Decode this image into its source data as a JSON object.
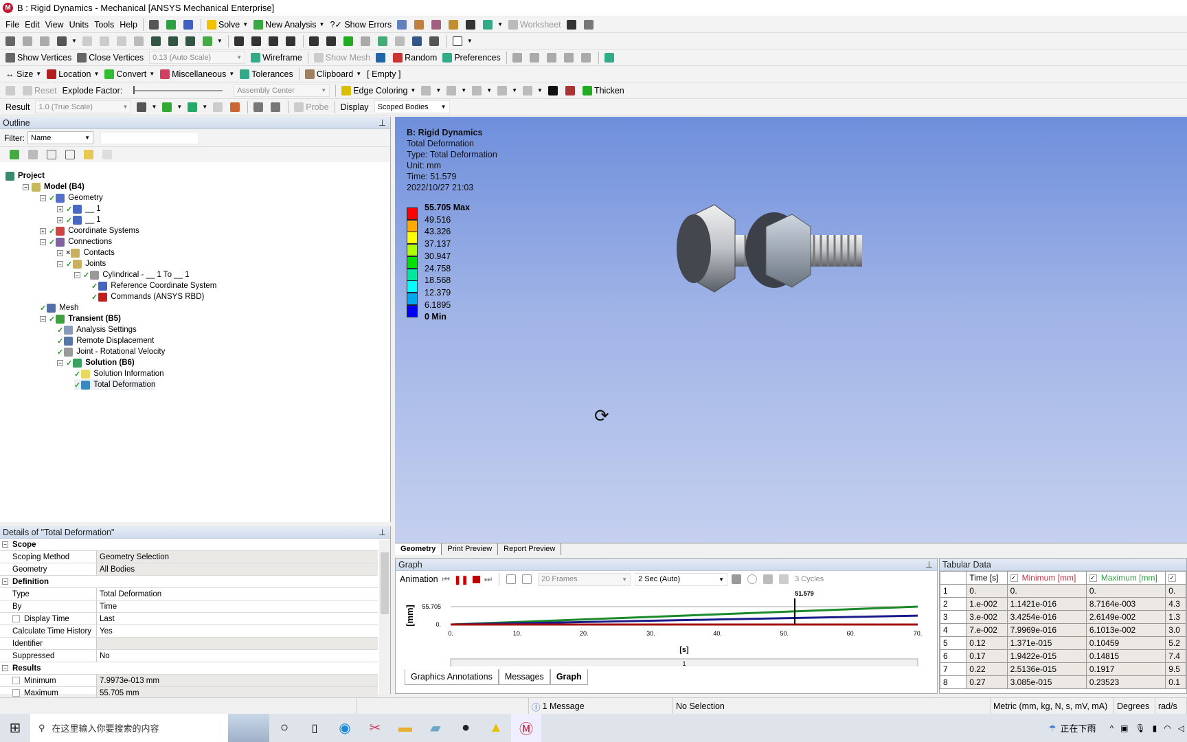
{
  "window": {
    "title": "B : Rigid Dynamics - Mechanical [ANSYS Mechanical Enterprise]",
    "app_icon": "M"
  },
  "toolbars": [
    [
      {
        "label": "File"
      },
      {
        "label": "Edit"
      },
      {
        "label": "View"
      },
      {
        "label": "Units"
      },
      {
        "label": "Tools"
      },
      {
        "label": "Help"
      },
      {
        "sep": 1
      },
      {
        "icon": "command-prompt-icon",
        "color": "#555"
      },
      {
        "icon": "check-icon",
        "color": "#2ea043"
      },
      {
        "icon": "insert-icon",
        "color": "#4060c0"
      },
      {
        "sep": 1
      },
      {
        "icon": "lightning-icon",
        "color": "#f2c200",
        "label": "Solve",
        "dd": 1
      },
      {
        "icon": "new-analysis-icon",
        "color": "#3aa840",
        "label": "New Analysis",
        "dd": 1
      },
      {
        "label": "?✓ Show Errors"
      },
      {
        "icon": "table-icon",
        "color": "#6080c0"
      },
      {
        "icon": "chart-icon",
        "color": "#c08040"
      },
      {
        "icon": "probe-icon",
        "color": "#a06080"
      },
      {
        "icon": "mesh-icon",
        "color": "#c09030"
      },
      {
        "icon": "text-icon",
        "color": "#333"
      },
      {
        "icon": "view-icon",
        "color": "#3a8",
        "dd": 1
      },
      {
        "icon": "worksheet-icon",
        "color": "#bbb",
        "label": "Worksheet",
        "dis": 1
      },
      {
        "icon": "pointer-icon",
        "color": "#333"
      },
      {
        "icon": "tag-icon",
        "color": "#777"
      }
    ],
    [
      {
        "icon": "select-icon",
        "color": "#666"
      },
      {
        "icon": "select-2-icon",
        "color": "#aaa"
      },
      {
        "icon": "select-3-icon",
        "color": "#aaa"
      },
      {
        "icon": "cursor-icon",
        "color": "#555",
        "dd": 1
      },
      {
        "icon": "vertex-icon",
        "color": "#ccc"
      },
      {
        "icon": "edge-icon",
        "color": "#ccc"
      },
      {
        "icon": "face-icon",
        "color": "#ccc"
      },
      {
        "icon": "body-icon",
        "color": "#bbb"
      },
      {
        "icon": "box-select-icon",
        "color": "#354"
      },
      {
        "icon": "box-select-2-icon",
        "color": "#354"
      },
      {
        "icon": "box-select-3-icon",
        "color": "#354"
      },
      {
        "icon": "named-select-icon",
        "color": "#4a4",
        "dd": 1
      },
      {
        "sep": 1
      },
      {
        "icon": "rotate-icon",
        "color": "#333"
      },
      {
        "icon": "pan-icon",
        "color": "#333"
      },
      {
        "icon": "zoom-icon",
        "color": "#333"
      },
      {
        "icon": "zoom-box-icon",
        "color": "#333"
      },
      {
        "sep": 1
      },
      {
        "icon": "zoom-fit-icon",
        "color": "#333"
      },
      {
        "icon": "zoom-window-icon",
        "color": "#333"
      },
      {
        "icon": "previous-view-icon",
        "color": "#2a2"
      },
      {
        "icon": "magnifier-icon",
        "color": "#aaa"
      },
      {
        "icon": "iso-icon",
        "color": "#4a7"
      },
      {
        "icon": "hide-icon",
        "color": "#bbb"
      },
      {
        "icon": "look-at-icon",
        "color": "#358"
      },
      {
        "icon": "print-icon",
        "color": "#555"
      },
      {
        "sep": 1
      },
      {
        "icon": "window-icon",
        "color": "#fff",
        "dd": 1
      }
    ],
    [
      {
        "icon": "vertices-icon",
        "color": "#666",
        "label": "Show Vertices"
      },
      {
        "icon": "close-vertices-icon",
        "color": "#666",
        "label": "Close Vertices"
      },
      {
        "combo": "0.13 (Auto Scale)",
        "w": 140
      },
      {
        "icon": "wireframe-icon",
        "color": "#3a8",
        "label": "Wireframe"
      },
      {
        "sep": 1
      },
      {
        "icon": "show-mesh-icon",
        "color": "#ccc",
        "label": "Show Mesh",
        "dis": 1
      },
      {
        "icon": "axes-icon",
        "color": "#26a"
      },
      {
        "icon": "random-colors-icon",
        "color": "#c33",
        "label": "Random"
      },
      {
        "icon": "preferences-icon",
        "color": "#3a8",
        "label": "Preferences"
      },
      {
        "sep": 1
      },
      {
        "icon": "triad-1-icon",
        "color": "#aaa"
      },
      {
        "icon": "triad-2-icon",
        "color": "#aaa"
      },
      {
        "icon": "triad-3-icon",
        "color": "#aaa"
      },
      {
        "icon": "triad-4-icon",
        "color": "#aaa"
      },
      {
        "icon": "triad-5-icon",
        "color": "#aaa"
      },
      {
        "sep": 1
      },
      {
        "icon": "cube-icon",
        "color": "#3a8"
      }
    ],
    [
      {
        "label": "↔ Size",
        "dd": 1
      },
      {
        "icon": "location-icon",
        "color": "#b02020",
        "label": "Location",
        "dd": 1
      },
      {
        "icon": "convert-icon",
        "color": "#3b3",
        "label": "Convert",
        "dd": 1
      },
      {
        "icon": "miscellaneous-icon",
        "color": "#d04060",
        "label": "Miscellaneous",
        "dd": 1
      },
      {
        "icon": "tolerances-icon",
        "color": "#3a8",
        "label": "Tolerances"
      },
      {
        "sep": 1
      },
      {
        "icon": "clipboard-icon",
        "color": "#a08060",
        "label": "Clipboard",
        "dd": 1
      },
      {
        "label": "[ Empty ]"
      }
    ],
    [
      {
        "icon": "explode-icon",
        "color": "#ccc"
      },
      {
        "icon": "reset-icon",
        "color": "#ccc",
        "label": "Reset",
        "dis": 1
      },
      {
        "label": "Explode Factor:"
      },
      {
        "slider": 1
      },
      {
        "combo": "Assembly Center",
        "w": 140
      },
      {
        "sep": 1
      },
      {
        "icon": "edge-coloring-icon",
        "color": "#d8c000",
        "label": "Edge Coloring",
        "dd": 1
      },
      {
        "icon": "edge-0-icon",
        "color": "#bbb",
        "dd": 1
      },
      {
        "icon": "edge-1-icon",
        "color": "#bbb",
        "dd": 1
      },
      {
        "icon": "edge-2-icon",
        "color": "#bbb",
        "dd": 1
      },
      {
        "icon": "edge-3-icon",
        "color": "#bbb",
        "dd": 1
      },
      {
        "icon": "edge-x-icon",
        "color": "#bbb",
        "dd": 1
      },
      {
        "icon": "pin-icon",
        "color": "#111"
      },
      {
        "icon": "thin-icon",
        "color": "#a33"
      },
      {
        "icon": "thicken-icon",
        "color": "#2a2",
        "label": "Thicken"
      }
    ],
    [
      {
        "label": "Result"
      },
      {
        "combo": "1.0 (True Scale)",
        "w": 140
      },
      {
        "icon": "geometry-display-icon",
        "color": "#555",
        "dd": 1
      },
      {
        "icon": "contours-icon",
        "color": "#3a3",
        "dd": 1
      },
      {
        "icon": "edges-icon",
        "color": "#2a6",
        "dd": 1
      },
      {
        "icon": "vector-icon",
        "color": "#ccc"
      },
      {
        "icon": "arrows-icon",
        "color": "#c63"
      },
      {
        "sep": 1
      },
      {
        "icon": "max-icon",
        "color": "#777"
      },
      {
        "icon": "min-icon",
        "color": "#777"
      },
      {
        "sep": 1
      },
      {
        "icon": "probe-icon",
        "color": "#ccc",
        "label": "Probe",
        "dis": 1
      },
      {
        "sep": 1
      },
      {
        "label": "Display"
      },
      {
        "combo": "Scoped Bodies",
        "w": 110,
        "active": 1
      }
    ]
  ],
  "outline": {
    "title": "Outline",
    "filter_label": "Filter:",
    "filter_value": "Name",
    "tree": [
      {
        "label": "Project",
        "level": 0,
        "bold": 1,
        "icon": "project-icon",
        "color": "#3a8a6a"
      },
      {
        "label": "Model (B4)",
        "level": 1,
        "bold": 1,
        "exp": "-",
        "icon": "model-icon",
        "color": "#c8b860"
      },
      {
        "label": "Geometry",
        "level": 2,
        "exp": "-",
        "chk": 1,
        "icon": "geometry-icon",
        "color": "#5570c8"
      },
      {
        "label": "__ 1",
        "level": 3,
        "exp": "+",
        "chk": 1,
        "icon": "body-icon",
        "color": "#4a68c0"
      },
      {
        "label": "__ 1",
        "level": 3,
        "exp": "+",
        "chk": 1,
        "icon": "body-icon",
        "color": "#4a68c0"
      },
      {
        "label": "Coordinate Systems",
        "level": 2,
        "exp": "+",
        "chk": 1,
        "icon": "coordinate-systems-icon",
        "color": "#c44"
      },
      {
        "label": "Connections",
        "level": 2,
        "exp": "-",
        "chk": 1,
        "icon": "connections-icon",
        "color": "#8060a0"
      },
      {
        "label": "Contacts",
        "level": 3,
        "exp": "+",
        "chk": 0,
        "icon": "contacts-icon",
        "color": "#c8b060"
      },
      {
        "label": "Joints",
        "level": 3,
        "exp": "-",
        "chk": 1,
        "icon": "joints-icon",
        "color": "#c8b060"
      },
      {
        "label": "Cylindrical - __ 1 To __ 1",
        "level": 4,
        "exp": "-",
        "chk": 1,
        "icon": "joint-icon",
        "color": "#999"
      },
      {
        "label": "Reference Coordinate System",
        "level": 5,
        "chk": 1,
        "icon": "coordinate-system-icon",
        "color": "#4466c0"
      },
      {
        "label": "Commands (ANSYS RBD)",
        "level": 5,
        "chk": 1,
        "icon": "commands-icon",
        "color": "#c02020"
      },
      {
        "label": "Mesh",
        "level": 2,
        "chk": 1,
        "icon": "mesh-icon",
        "color": "#5570a8"
      },
      {
        "label": "Transient (B5)",
        "level": 2,
        "bold": 1,
        "exp": "-",
        "chk": 1,
        "icon": "transient-icon",
        "color": "#40a040"
      },
      {
        "label": "Analysis Settings",
        "level": 3,
        "chk": 1,
        "icon": "analysis-settings-icon",
        "color": "#8899bb"
      },
      {
        "label": "Remote Displacement",
        "level": 3,
        "chk": 1,
        "icon": "remote-displacement-icon",
        "color": "#5577aa"
      },
      {
        "label": "Joint - Rotational Velocity",
        "level": 3,
        "chk": 1,
        "icon": "joint-velocity-icon",
        "color": "#999"
      },
      {
        "label": "Solution (B6)",
        "level": 3,
        "bold": 1,
        "exp": "-",
        "chk": 1,
        "icon": "solution-icon",
        "color": "#3aa060"
      },
      {
        "label": "Solution Information",
        "level": 4,
        "chk": 1,
        "icon": "solution-information-icon",
        "color": "#e8d860"
      },
      {
        "label": "Total Deformation",
        "level": 4,
        "chk": 1,
        "icon": "total-deformation-icon",
        "color": "#3a8ac0",
        "selected": 1
      }
    ]
  },
  "details": {
    "title": "Details of \"Total Deformation\"",
    "rows": [
      {
        "group": "Scope"
      },
      {
        "k": "Scoping Method",
        "v": "Geometry Selection",
        "shade": 1
      },
      {
        "k": "Geometry",
        "v": "All Bodies",
        "shade": 1
      },
      {
        "group": "Definition"
      },
      {
        "k": "Type",
        "v": "Total Deformation"
      },
      {
        "k": "By",
        "v": "Time"
      },
      {
        "k": "Display Time",
        "v": "Last",
        "cb": 1
      },
      {
        "k": "Calculate Time History",
        "v": "Yes"
      },
      {
        "k": "Identifier",
        "v": "",
        "shade": 1
      },
      {
        "k": "Suppressed",
        "v": "No"
      },
      {
        "group": "Results"
      },
      {
        "k": "Minimum",
        "v": "7.9973e-013 mm",
        "cb": 1,
        "shade": 1
      },
      {
        "k": "Maximum",
        "v": "55.705 mm",
        "cb": 1,
        "shade": 1
      }
    ]
  },
  "viewport": {
    "title": "B: Rigid Dynamics",
    "lines": [
      "Total Deformation",
      "Type: Total Deformation",
      "Unit: mm",
      "Time: 51.579",
      "2022/10/27 21:03"
    ],
    "legend": [
      {
        "label": "55.705 Max",
        "color": "#ff0000",
        "bold": 1
      },
      {
        "label": "49.516",
        "color": "#ffaa00"
      },
      {
        "label": "43.326",
        "color": "#ffff00"
      },
      {
        "label": "37.137",
        "color": "#b0ff00"
      },
      {
        "label": "30.947",
        "color": "#00e000"
      },
      {
        "label": "24.758",
        "color": "#00e8a0"
      },
      {
        "label": "18.568",
        "color": "#00ffff"
      },
      {
        "label": "12.379",
        "color": "#00a8f0"
      },
      {
        "label": "6.1895",
        "color": "#0000ff"
      },
      {
        "label": "0 Min",
        "bold": 1
      }
    ],
    "tabs": [
      "Geometry",
      "Print Preview",
      "Report Preview"
    ],
    "active_tab": "Geometry"
  },
  "graph": {
    "title": "Graph",
    "animation_label": "Animation",
    "frames": "20 Frames",
    "duration": "2 Sec (Auto)",
    "cycles": "3 Cycles",
    "step_label": "1",
    "tabs": [
      "Graphics Annotations",
      "Messages",
      "Graph"
    ],
    "active_tab": "Graph"
  },
  "chart_data": {
    "type": "line",
    "xlabel": "[s]",
    "ylabel": "[mm]",
    "xlim": [
      0,
      70
    ],
    "ylim": [
      0,
      55.705
    ],
    "xticks": [
      "0.",
      "10.",
      "20.",
      "30.",
      "40.",
      "50.",
      "60.",
      "70."
    ],
    "yticks": [
      "0.",
      "55.705"
    ],
    "cursor": {
      "x": 51.579,
      "label": "51.579"
    },
    "x": [
      0,
      70
    ],
    "series": [
      {
        "values": [
          0,
          55.705
        ],
        "color": "#1a8a2a"
      },
      {
        "values": [
          0,
          27.5
        ],
        "color": "#1a1a8a"
      },
      {
        "values": [
          0,
          0
        ],
        "color": "#a01010"
      }
    ]
  },
  "tabular": {
    "title": "Tabular Data",
    "headers": [
      "",
      "Time [s]",
      "Minimum [mm]",
      "Maximum [mm]",
      ""
    ],
    "header_colors": [
      "",
      "",
      "#c03040",
      "#30a040",
      ""
    ],
    "rows": [
      [
        "1",
        "0.",
        "0.",
        "0.",
        "0."
      ],
      [
        "2",
        "1.e-002",
        "1.1421e-016",
        "8.7164e-003",
        "4.3"
      ],
      [
        "3",
        "3.e-002",
        "3.4254e-016",
        "2.6149e-002",
        "1.3"
      ],
      [
        "4",
        "7.e-002",
        "7.9969e-016",
        "6.1013e-002",
        "3.0"
      ],
      [
        "5",
        "0.12",
        "1.371e-015",
        "0.10459",
        "5.2"
      ],
      [
        "6",
        "0.17",
        "1.9422e-015",
        "0.14815",
        "7.4"
      ],
      [
        "7",
        "0.22",
        "2.5136e-015",
        "0.1917",
        "9.5"
      ],
      [
        "8",
        "0.27",
        "3.085e-015",
        "0.23523",
        "0.1"
      ]
    ]
  },
  "status": {
    "messages": "1 Message",
    "selection": "No Selection",
    "units": "Metric (mm, kg, N, s, mV, mA)",
    "angle": "Degrees",
    "rate": "rad/s"
  },
  "taskbar": {
    "search_placeholder": "在这里输入你要搜索的内容",
    "weather": "正在下雨"
  }
}
